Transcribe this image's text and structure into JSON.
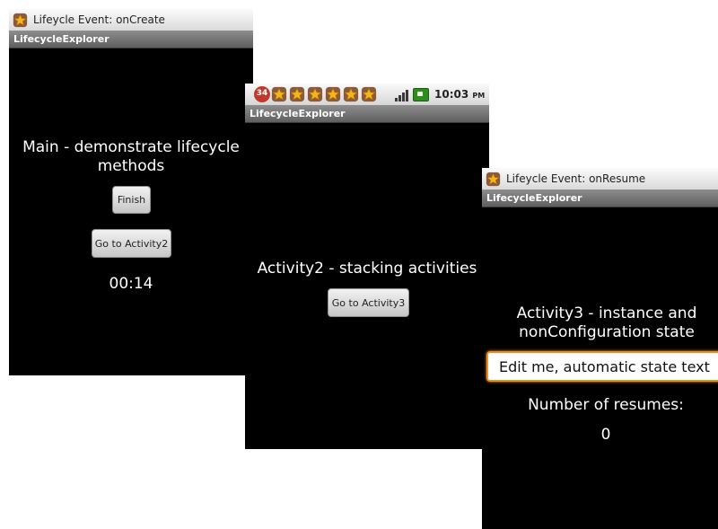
{
  "screen1": {
    "notification_text": "Lifeycle Event: onCreate",
    "app_title": "LifecycleExplorer",
    "heading": "Main - demonstrate lifecycle methods",
    "finish_button": "Finish",
    "goto_button": "Go to Activity2",
    "timer": "00:14"
  },
  "screen2": {
    "notification_badge": "34",
    "clock": "10:03",
    "clock_suffix": "PM",
    "app_title": "LifecycleExplorer",
    "heading": "Activity2 - stacking activities",
    "goto_button": "Go to Activity3"
  },
  "screen3": {
    "notification_text": "Lifeycle Event: onResume",
    "app_title": "LifecycleExplorer",
    "heading": "Activity3 - instance and nonConfiguration state",
    "edit_value": "Edit me, automatic state text",
    "resumes_label": "Number of resumes:",
    "resumes_count": "0"
  },
  "icons": {
    "notification": "star-notification-icon",
    "signal": "signal-icon",
    "battery": "battery-icon"
  },
  "colors": {
    "screen_bg": "#000000",
    "edit_focus": "#f28c1c",
    "star_fill": "#f4b41a",
    "badge": "#c0392b"
  }
}
